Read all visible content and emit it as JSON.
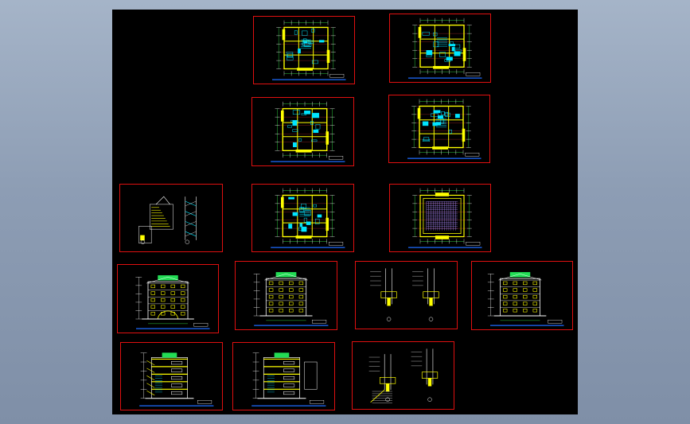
{
  "viewport": {
    "background": "#8d9db4",
    "canvas_background": "#000000"
  },
  "colors": {
    "frame": "#e01010",
    "wall": "#ffff00",
    "fixture": "#00e5ff",
    "dimension": "#2ecc40",
    "annotation": "#ffffff",
    "title_bar": "#1e6bff",
    "hatch": "#b08cff"
  },
  "sheets": [
    {
      "id": "plan-1",
      "type": "floor-plan",
      "variant": 1
    },
    {
      "id": "plan-2",
      "type": "floor-plan",
      "variant": 2
    },
    {
      "id": "plan-3",
      "type": "floor-plan",
      "variant": 3
    },
    {
      "id": "plan-4",
      "type": "floor-plan",
      "variant": 4
    },
    {
      "id": "detail-1",
      "type": "stair-detail",
      "variant": 1
    },
    {
      "id": "plan-5",
      "type": "floor-plan",
      "variant": 5
    },
    {
      "id": "roof-plan",
      "type": "roof-plan",
      "variant": 1
    },
    {
      "id": "elev-1",
      "type": "elevation",
      "variant": 1
    },
    {
      "id": "elev-2",
      "type": "elevation",
      "variant": 2
    },
    {
      "id": "detail-2",
      "type": "wall-detail",
      "variant": 2
    },
    {
      "id": "elev-3",
      "type": "elevation",
      "variant": 3
    },
    {
      "id": "section-1",
      "type": "section",
      "variant": 1
    },
    {
      "id": "section-2",
      "type": "section",
      "variant": 2
    },
    {
      "id": "detail-3",
      "type": "wall-detail",
      "variant": 3
    }
  ]
}
